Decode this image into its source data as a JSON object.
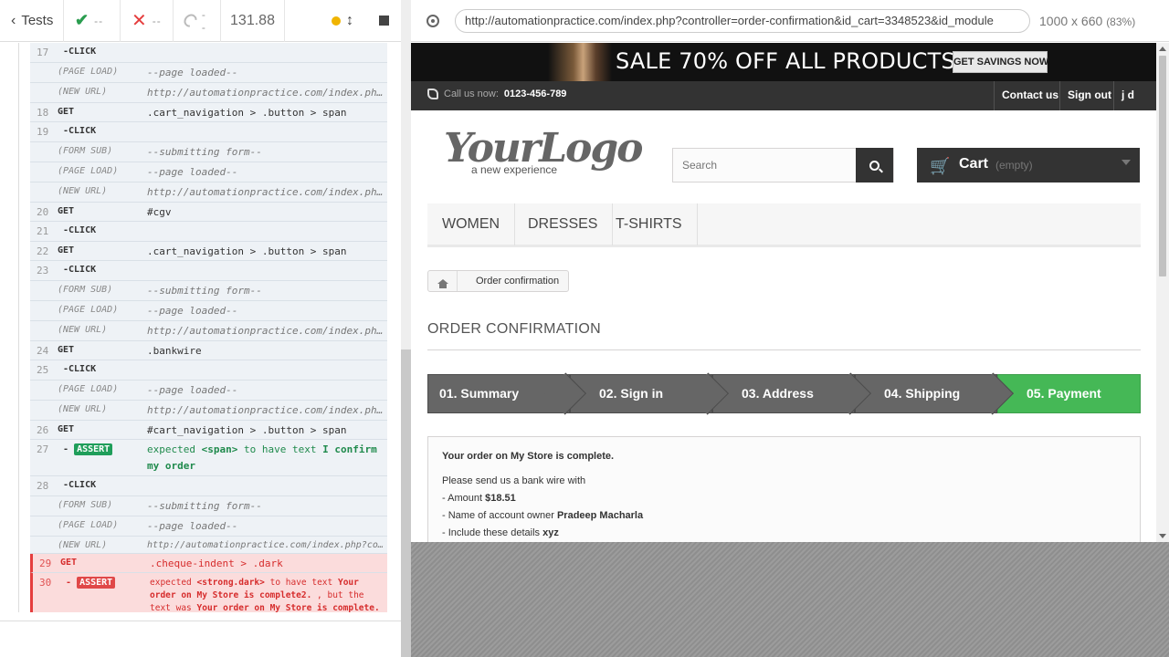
{
  "header": {
    "tests_label": "Tests",
    "passed": "--",
    "failed": "--",
    "pending": "--",
    "duration": "131.88"
  },
  "commands": [
    {
      "num": "17",
      "cmd": "-CLICK",
      "msg": ""
    },
    {
      "num": "",
      "cmd": "(PAGE LOAD)",
      "msg": "--page loaded--"
    },
    {
      "num": "",
      "cmd": "(NEW URL)",
      "msg": "http://automationpractice.com/index.php?c…"
    },
    {
      "num": "18",
      "cmd": "GET",
      "msg": ".cart_navigation > .button > span"
    },
    {
      "num": "19",
      "cmd": "-CLICK",
      "msg": ""
    },
    {
      "num": "",
      "cmd": "(FORM SUB)",
      "msg": "--submitting form--"
    },
    {
      "num": "",
      "cmd": "(PAGE LOAD)",
      "msg": "--page loaded--"
    },
    {
      "num": "",
      "cmd": "(NEW URL)",
      "msg": "http://automationpractice.com/index.php?c…"
    },
    {
      "num": "20",
      "cmd": "GET",
      "msg": "#cgv"
    },
    {
      "num": "21",
      "cmd": "-CLICK",
      "msg": ""
    },
    {
      "num": "22",
      "cmd": "GET",
      "msg": ".cart_navigation > .button > span"
    },
    {
      "num": "23",
      "cmd": "-CLICK",
      "msg": ""
    },
    {
      "num": "",
      "cmd": "(FORM SUB)",
      "msg": "--submitting form--"
    },
    {
      "num": "",
      "cmd": "(PAGE LOAD)",
      "msg": "--page loaded--"
    },
    {
      "num": "",
      "cmd": "(NEW URL)",
      "msg": "http://automationpractice.com/index.php?c…"
    },
    {
      "num": "24",
      "cmd": "GET",
      "msg": ".bankwire"
    },
    {
      "num": "25",
      "cmd": "-CLICK",
      "msg": ""
    },
    {
      "num": "",
      "cmd": "(PAGE LOAD)",
      "msg": "--page loaded--"
    },
    {
      "num": "",
      "cmd": "(NEW URL)",
      "msg": "http://automationpractice.com/index.php?f…"
    },
    {
      "num": "26",
      "cmd": "GET",
      "msg": "#cart_navigation > .button > span"
    },
    {
      "num": "27",
      "cmd": "-",
      "badge": "ASSERT",
      "msg_a": "expected",
      "msg_b": "<span>",
      "msg_c": "to have text",
      "msg_d": "I confirm my order"
    },
    {
      "num": "28",
      "cmd": "-CLICK",
      "msg": ""
    },
    {
      "num": "",
      "cmd": "(FORM SUB)",
      "msg": "--submitting form--"
    },
    {
      "num": "",
      "cmd": "(PAGE LOAD)",
      "msg": "--page loaded--"
    },
    {
      "num": "",
      "cmd": "(NEW URL)",
      "msg": "http://automationpractice.com/index.php?controll…"
    },
    {
      "num": "29",
      "cmd": "GET",
      "msg": ".cheque-indent > .dark"
    },
    {
      "num": "30",
      "cmd": "-",
      "badge": "ASSERT",
      "fail_a": "expected",
      "fail_b": "<strong.dark>",
      "fail_c": "to have text",
      "fail_d": "Your order on My Store is complete2.",
      "fail_e": ", but the text was",
      "fail_f": "Your order on My Store is complete."
    }
  ],
  "aut": {
    "url": "http://automationpractice.com/index.php?controller=order-confirmation&id_cart=3348523&id_module",
    "viewport": "1000 x 660",
    "zoom": "(83%)"
  },
  "store": {
    "banner_text": "SALE 70% OFF ALL PRODUCTS",
    "banner_button": "GET SAVINGS NOW",
    "call_label": "Call us now:",
    "phone": "0123-456-789",
    "nav_contact": "Contact us",
    "nav_signout": "Sign out",
    "nav_user": "j d",
    "logo_main": "YourLogo",
    "logo_sub": "a new experience",
    "search_placeholder": "Search",
    "cart_label": "Cart",
    "cart_status": "(empty)",
    "menu": [
      "WOMEN",
      "DRESSES",
      "T-SHIRTS"
    ],
    "breadcrumb": "Order confirmation",
    "heading": "ORDER CONFIRMATION",
    "steps": [
      "01. Summary",
      "02. Sign in",
      "03. Address",
      "04. Shipping",
      "05. Payment"
    ],
    "order_complete": "Your order on My Store is complete.",
    "bank_line": "Please send us a bank wire with",
    "amount_label": "- Amount",
    "amount": "$18.51",
    "owner_label": "- Name of account owner",
    "owner": "Pradeep Macharla",
    "details_label": "- Include these details",
    "details": "xyz"
  },
  "colors": {
    "pass_green": "#1f9e5a",
    "fail_red": "#e04848",
    "active_step": "#45b856"
  }
}
